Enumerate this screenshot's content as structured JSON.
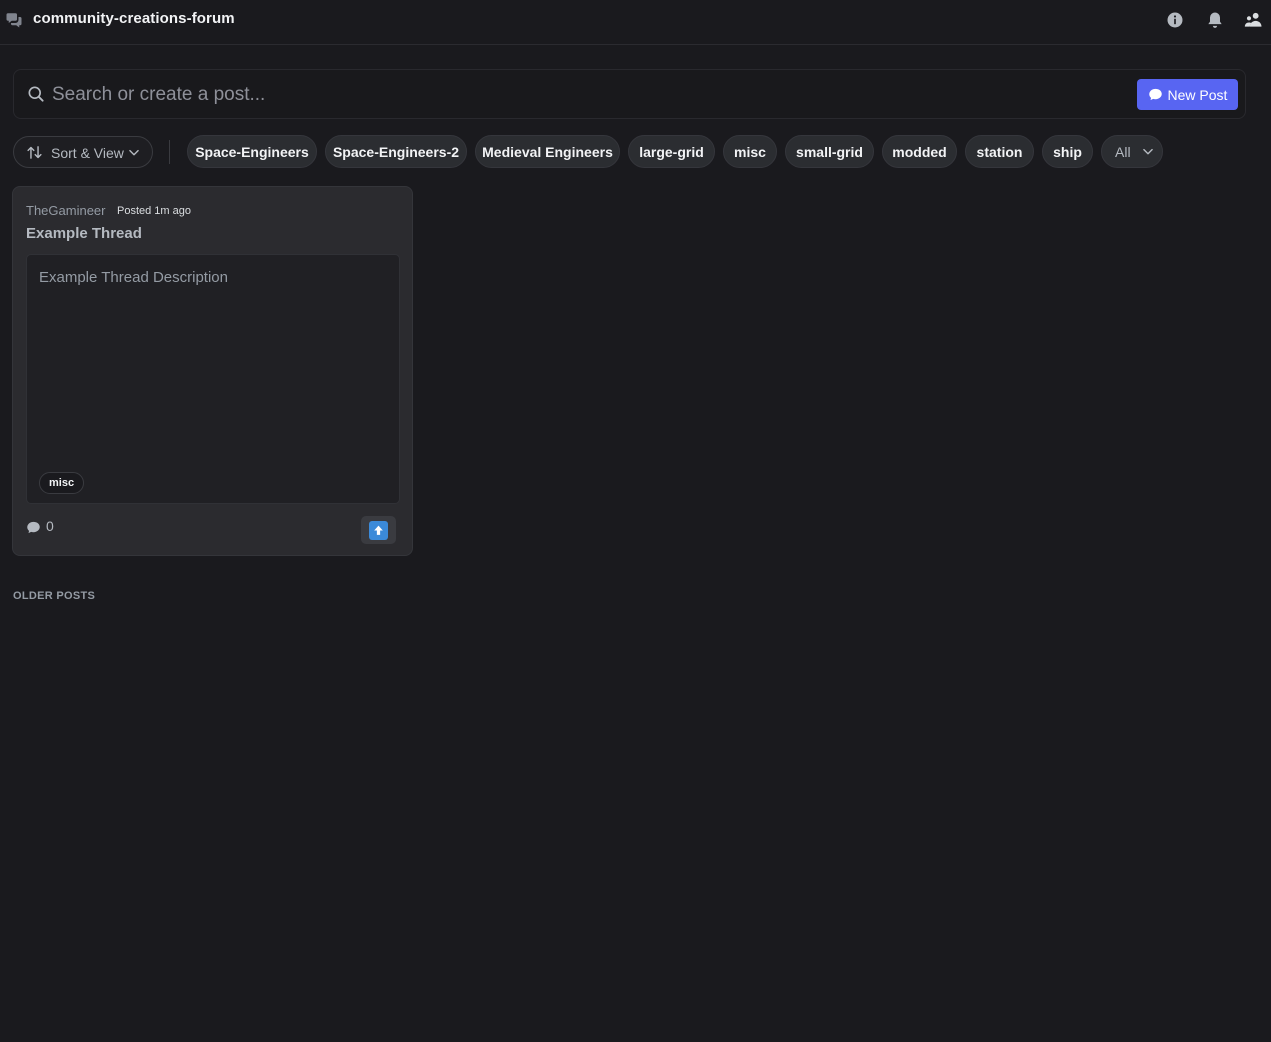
{
  "header": {
    "channel_name": "community-creations-forum",
    "icons": [
      "forum-icon",
      "info-icon",
      "bell-icon",
      "members-icon"
    ]
  },
  "search": {
    "placeholder": "Search or create a post...",
    "value": "",
    "new_post_label": "New Post"
  },
  "filters": {
    "sort_label": "Sort & View",
    "tags": [
      "Space-Engineers",
      "Space-Engineers-2",
      "Medieval Engineers",
      "large-grid",
      "misc",
      "small-grid",
      "modded",
      "station",
      "ship"
    ],
    "all_label": "All"
  },
  "posts": [
    {
      "author": "TheGamineer",
      "posted": "Posted 1m ago",
      "title": "Example Thread",
      "description": "Example Thread Description",
      "tag": "misc",
      "reply_count": "0"
    }
  ],
  "older_posts_label": "OLDER POSTS",
  "colors": {
    "background": "#1a1a1e",
    "accent": "#5865f2",
    "upvote": "#3b8ad9"
  }
}
